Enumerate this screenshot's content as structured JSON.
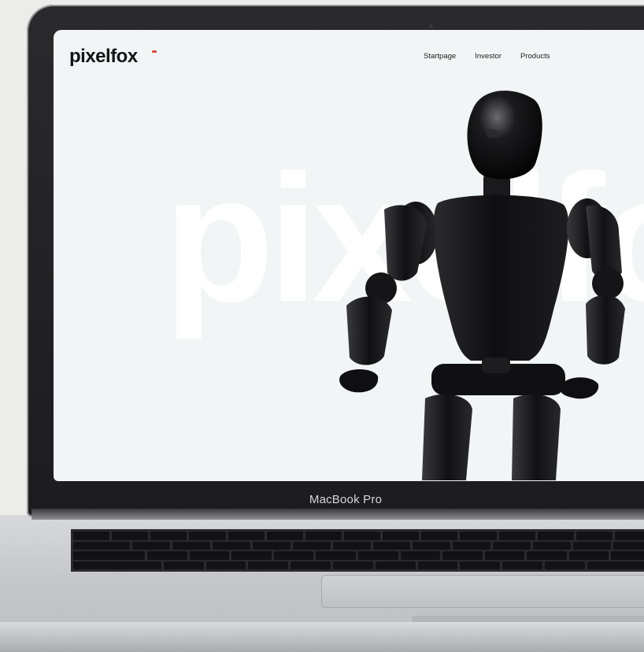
{
  "site": {
    "logo": "pixelfox",
    "background_word": "pixelfox"
  },
  "nav": {
    "items": [
      {
        "label": "Startpage"
      },
      {
        "label": "Investor"
      },
      {
        "label": "Products"
      }
    ]
  },
  "device": {
    "label": "MacBook Pro"
  },
  "colors": {
    "screen_bg": "#f1f5f5",
    "accent": "#d94d3a",
    "text": "#141416"
  },
  "hero_image": {
    "icon": "humanoid-robot-image"
  }
}
